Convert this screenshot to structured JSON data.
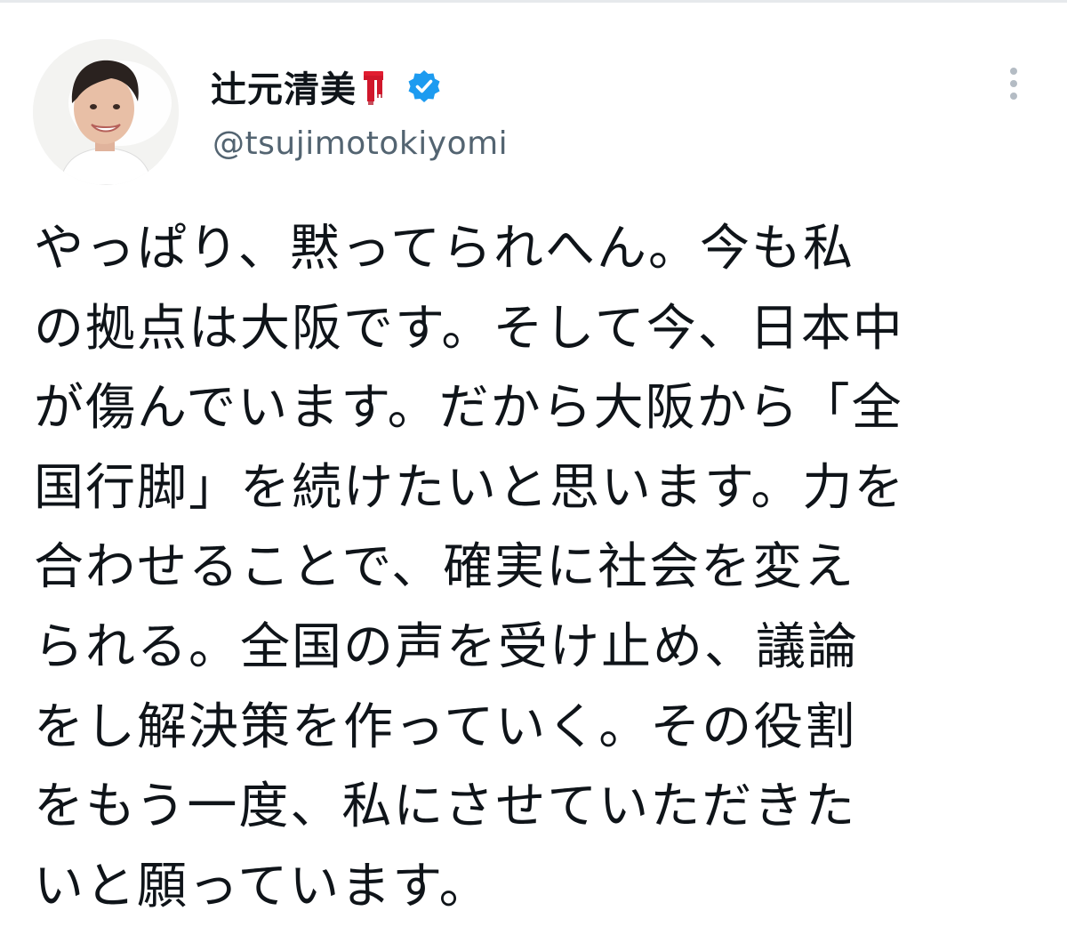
{
  "tweet": {
    "author": {
      "display_name": "辻元清美",
      "handle": "@tsujimotokiyomi",
      "name_emoji_icon": "red-scarf-icon",
      "verified_icon": "verified-badge-icon",
      "avatar_icon": "profile-photo"
    },
    "more_icon": "vertical-ellipsis-icon",
    "text_lines": [
      "やっぱり、黙ってられへん。今も私",
      "の拠点は大阪です。そして今、日本中",
      "が傷んでいます。だから大阪から「全",
      "国行脚」を続けたいと思います。力を",
      "合わせることで、確実に社会を変え",
      "られる。全国の声を受け止め、議論",
      "をし解決策を作っていく。その役割",
      "をもう一度、私にさせていただきた",
      "いと願っています。"
    ]
  },
  "colors": {
    "text_primary": "#0f1419",
    "text_secondary": "#536471",
    "verified_blue": "#1d9bf0",
    "scarf_red": "#d0172b",
    "divider": "#e6e9ec"
  }
}
